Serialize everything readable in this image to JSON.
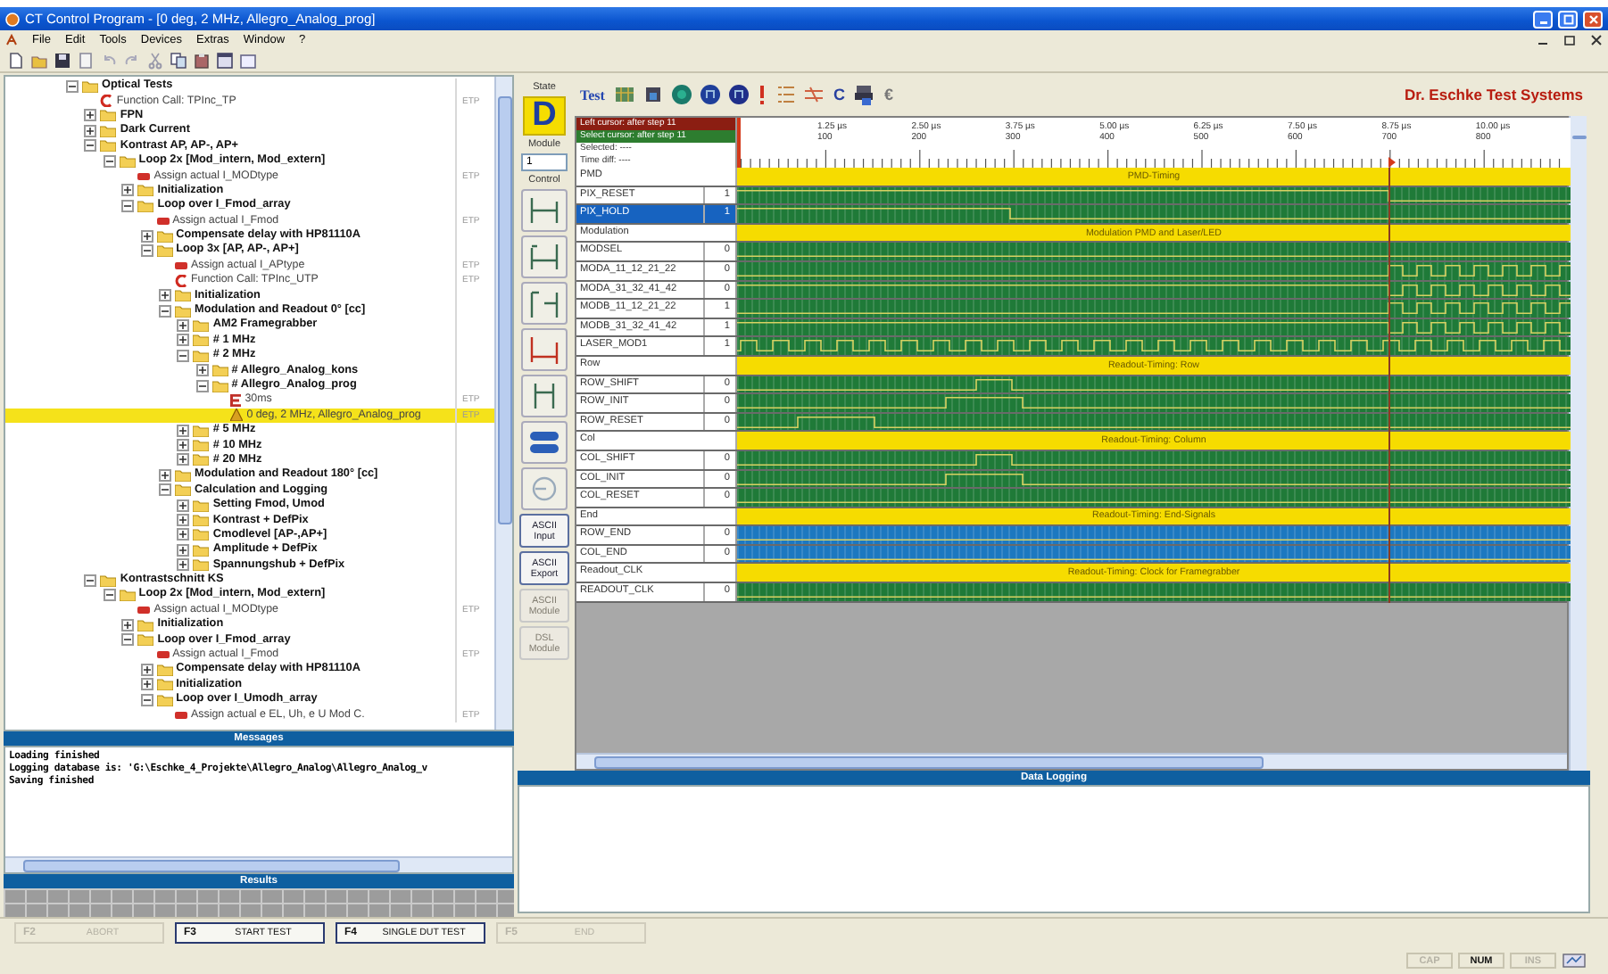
{
  "window": {
    "title": "CT Control Program - [0 deg, 2 MHz, Allegro_Analog_prog]"
  },
  "menu": [
    "File",
    "Edit",
    "Tools",
    "Devices",
    "Extras",
    "Window",
    "?"
  ],
  "tree": [
    {
      "label": "Optical Tests",
      "kind": "folder",
      "expanded": true,
      "selected": false,
      "children": [
        {
          "label": "Function Call: TPInc_TP",
          "kind": "function",
          "tag": "ETP",
          "selected": false
        },
        {
          "label": "FPN",
          "kind": "folder",
          "expanded": false,
          "selected": false
        },
        {
          "label": "Dark Current",
          "kind": "folder",
          "expanded": false,
          "selected": false
        },
        {
          "label": "Kontrast AP, AP-, AP+",
          "kind": "folder",
          "expanded": true,
          "selected": false,
          "children": [
            {
              "label": "Loop 2x [Mod_intern, Mod_extern]",
              "kind": "folder",
              "expanded": true,
              "selected": false,
              "children": [
                {
                  "label": "Assign actual I_MODtype",
                  "kind": "assign",
                  "tag": "ETP",
                  "selected": false
                },
                {
                  "label": "Initialization",
                  "kind": "folder",
                  "expanded": false,
                  "selected": false
                },
                {
                  "label": "Loop over I_Fmod_array",
                  "kind": "folder",
                  "expanded": true,
                  "selected": false,
                  "children": [
                    {
                      "label": "Assign actual I_Fmod",
                      "kind": "assign",
                      "tag": "ETP",
                      "selected": false
                    },
                    {
                      "label": "Compensate delay with HP81110A",
                      "kind": "folder",
                      "expanded": false,
                      "selected": false
                    },
                    {
                      "label": "Loop 3x [AP, AP-, AP+]",
                      "kind": "folder",
                      "expanded": true,
                      "selected": false,
                      "children": [
                        {
                          "label": "Assign actual I_APtype",
                          "kind": "assign",
                          "tag": "ETP",
                          "selected": false
                        },
                        {
                          "label": "Function Call: TPInc_UTP",
                          "kind": "function",
                          "tag": "ETP",
                          "selected": false
                        },
                        {
                          "label": "Initialization",
                          "kind": "folder",
                          "expanded": false,
                          "selected": false
                        },
                        {
                          "label": "Modulation and Readout 0° [cc]",
                          "kind": "folder",
                          "expanded": true,
                          "selected": false,
                          "children": [
                            {
                              "label": "AM2 Framegrabber",
                              "kind": "folder",
                              "expanded": false,
                              "selected": false
                            },
                            {
                              "label": "# 1 MHz",
                              "kind": "folder",
                              "expanded": false,
                              "selected": false
                            },
                            {
                              "label": "# 2 MHz",
                              "kind": "folder",
                              "expanded": true,
                              "selected": false,
                              "children": [
                                {
                                  "label": "# Allegro_Analog_kons",
                                  "kind": "folder",
                                  "expanded": false,
                                  "selected": false
                                },
                                {
                                  "label": "# Allegro_Analog_prog",
                                  "kind": "folder",
                                  "expanded": true,
                                  "selected": false,
                                  "children": [
                                    {
                                      "label": "30ms",
                                      "kind": "wait",
                                      "tag": "ETP",
                                      "selected": false
                                    },
                                    {
                                      "label": "0 deg, 2 MHz, Allegro_Analog_prog",
                                      "kind": "step",
                                      "tag": "ETP",
                                      "selected": true
                                    }
                                  ]
                                }
                              ]
                            },
                            {
                              "label": "# 5 MHz",
                              "kind": "folder",
                              "expanded": false,
                              "selected": false
                            },
                            {
                              "label": "# 10 MHz",
                              "kind": "folder",
                              "expanded": false,
                              "selected": false
                            },
                            {
                              "label": "# 20 MHz",
                              "kind": "folder",
                              "expanded": false,
                              "selected": false
                            }
                          ]
                        },
                        {
                          "label": "Modulation and Readout 180° [cc]",
                          "kind": "folder",
                          "expanded": false,
                          "selected": false
                        },
                        {
                          "label": "Calculation and Logging",
                          "kind": "folder",
                          "expanded": true,
                          "selected": false,
                          "children": [
                            {
                              "label": "Setting Fmod, Umod",
                              "kind": "folder",
                              "expanded": false,
                              "selected": false
                            },
                            {
                              "label": "Kontrast + DefPix",
                              "kind": "folder",
                              "expanded": false,
                              "selected": false
                            },
                            {
                              "label": "Cmodlevel [AP-,AP+]",
                              "kind": "folder",
                              "expanded": false,
                              "selected": false
                            },
                            {
                              "label": "Amplitude + DefPix",
                              "kind": "folder",
                              "expanded": false,
                              "selected": false
                            },
                            {
                              "label": "Spannungshub + DefPix",
                              "kind": "folder",
                              "expanded": false,
                              "selected": false
                            }
                          ]
                        }
                      ]
                    }
                  ]
                }
              ]
            }
          ]
        },
        {
          "label": "Kontrastschnitt KS",
          "kind": "folder",
          "expanded": true,
          "selected": false,
          "children": [
            {
              "label": "Loop 2x [Mod_intern, Mod_extern]",
              "kind": "folder",
              "expanded": true,
              "selected": false,
              "children": [
                {
                  "label": "Assign actual I_MODtype",
                  "kind": "assign",
                  "tag": "ETP",
                  "selected": false
                },
                {
                  "label": "Initialization",
                  "kind": "folder",
                  "expanded": false,
                  "selected": false
                },
                {
                  "label": "Loop over I_Fmod_array",
                  "kind": "folder",
                  "expanded": true,
                  "selected": false,
                  "children": [
                    {
                      "label": "Assign actual I_Fmod",
                      "kind": "assign",
                      "tag": "ETP",
                      "selected": false
                    },
                    {
                      "label": "Compensate delay with HP81110A",
                      "kind": "folder",
                      "expanded": false,
                      "selected": false
                    },
                    {
                      "label": "Initialization",
                      "kind": "folder",
                      "expanded": false,
                      "selected": false
                    },
                    {
                      "label": "Loop over I_Umodh_array",
                      "kind": "folder",
                      "expanded": true,
                      "selected": false,
                      "children": [
                        {
                          "label": "Assign actual e EL, Uh, e U Mod C.",
                          "kind": "assign",
                          "tag": "ETP",
                          "selected": false
                        }
                      ]
                    }
                  ]
                }
              ]
            }
          ]
        }
      ]
    }
  ],
  "messages": {
    "title": "Messages",
    "lines": [
      "Loading finished",
      "Logging database is: 'G:\\Eschke_4_Projekte\\Allegro_Analog\\Allegro_Analog_v",
      "Saving finished"
    ]
  },
  "results": {
    "title": "Results"
  },
  "side": {
    "state_label": "State",
    "state": "D",
    "module_label": "Module",
    "module": "1",
    "control_label": "Control",
    "buttons": [
      {
        "label": "ASCII Input",
        "disabled": false
      },
      {
        "label": "ASCII Export",
        "disabled": false
      },
      {
        "label": "ASCII Module",
        "disabled": true
      },
      {
        "label": "DSL Module",
        "disabled": true
      }
    ]
  },
  "toolbar": {
    "test": "Test",
    "c": "C",
    "euro": "€"
  },
  "brand": "Dr. Eschke Test Systems",
  "timing": {
    "cursor_info": [
      {
        "text": "Left cursor:  after step 11",
        "color": "#8b1e12"
      },
      {
        "text": "Select cursor: after step 11",
        "color": "#2d7d2f"
      },
      {
        "text": "Selected: ----"
      },
      {
        "text": "Time diff: ----"
      }
    ],
    "ruler": [
      {
        "time": "1.25 µs",
        "step": "100"
      },
      {
        "time": "2.50 µs",
        "step": "200"
      },
      {
        "time": "3.75 µs",
        "step": "300"
      },
      {
        "time": "5.00 µs",
        "step": "400"
      },
      {
        "time": "6.25 µs",
        "step": "500"
      },
      {
        "time": "7.50 µs",
        "step": "600"
      },
      {
        "time": "8.75 µs",
        "step": "700"
      },
      {
        "time": "10.00 µs",
        "step": "800"
      }
    ],
    "rows": [
      {
        "kind": "group",
        "name": "PMD",
        "title": "PMD-Timing",
        "selected": false
      },
      {
        "kind": "fall-late",
        "name": "PIX_RESET",
        "value": "1",
        "color": "#1f7a38",
        "selected": false
      },
      {
        "kind": "fall-mid",
        "name": "PIX_HOLD",
        "value": "1",
        "color": "#1f7a38",
        "selected": true
      },
      {
        "kind": "group",
        "name": "Modulation",
        "title": "Modulation PMD and Laser/LED",
        "selected": false
      },
      {
        "kind": "low",
        "name": "MODSEL",
        "value": "0",
        "color": "#1f7a38",
        "selected": false
      },
      {
        "kind": "clock-late",
        "name": "MODA_11_12_21_22",
        "value": "0",
        "color": "#1f7a38",
        "selected": false
      },
      {
        "kind": "clock-late-inv",
        "name": "MODA_31_32_41_42",
        "value": "0",
        "color": "#1f7a38",
        "selected": false
      },
      {
        "kind": "clock-late",
        "name": "MODB_11_12_21_22",
        "value": "1",
        "color": "#1f7a38",
        "selected": false
      },
      {
        "kind": "clock-late-inv",
        "name": "MODB_31_32_41_42",
        "value": "1",
        "color": "#1f7a38",
        "selected": false
      },
      {
        "kind": "clock",
        "name": "LASER_MOD1",
        "value": "1",
        "color": "#1f7a38",
        "selected": false
      },
      {
        "kind": "group",
        "name": "Row",
        "title": "Readout-Timing: Row",
        "selected": false
      },
      {
        "kind": "pulse-c",
        "name": "ROW_SHIFT",
        "value": "0",
        "color": "#1f7a38",
        "selected": false
      },
      {
        "kind": "pulse-b",
        "name": "ROW_INIT",
        "value": "0",
        "color": "#1f7a38",
        "selected": false
      },
      {
        "kind": "pulse-a",
        "name": "ROW_RESET",
        "value": "0",
        "color": "#1f7a38",
        "selected": false
      },
      {
        "kind": "group",
        "name": "Col",
        "title": "Readout-Timing: Column",
        "selected": false
      },
      {
        "kind": "pulse-c",
        "name": "COL_SHIFT",
        "value": "0",
        "color": "#1f7a38",
        "selected": false
      },
      {
        "kind": "pulse-b",
        "name": "COL_INIT",
        "value": "0",
        "color": "#1f7a38",
        "selected": false
      },
      {
        "kind": "low",
        "name": "COL_RESET",
        "value": "0",
        "color": "#1f7a38",
        "selected": false
      },
      {
        "kind": "group",
        "name": "End",
        "title": "Readout-Timing: End-Signals",
        "selected": false
      },
      {
        "kind": "low",
        "name": "ROW_END",
        "value": "0",
        "color": "#1c78c0",
        "selected": false
      },
      {
        "kind": "low",
        "name": "COL_END",
        "value": "0",
        "color": "#1c78c0",
        "selected": false
      },
      {
        "kind": "group",
        "name": "Readout_CLK",
        "title": "Readout-Timing: Clock for Framegrabber",
        "selected": false
      },
      {
        "kind": "low",
        "name": "READOUT_CLK",
        "value": "0",
        "color": "#1f7a38",
        "selected": false
      }
    ]
  },
  "data_logging": {
    "title": "Data Logging"
  },
  "function_keys": [
    {
      "key": "F2",
      "label": "ABORT",
      "disabled": true
    },
    {
      "key": "F3",
      "label": "START TEST",
      "disabled": false
    },
    {
      "key": "F4",
      "label": "SINGLE DUT TEST",
      "disabled": false
    },
    {
      "key": "F5",
      "label": "END",
      "disabled": true
    }
  ],
  "status": [
    {
      "label": "CAP",
      "on": false
    },
    {
      "label": "NUM",
      "on": true
    },
    {
      "label": "INS",
      "on": false
    }
  ]
}
